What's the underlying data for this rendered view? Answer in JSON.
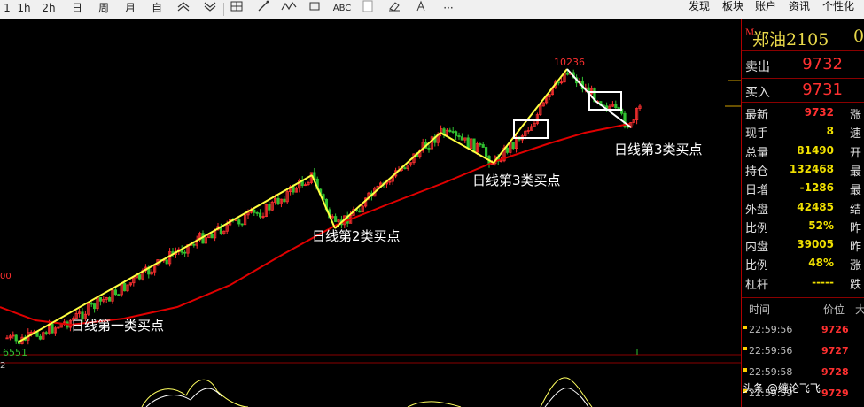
{
  "toolbar": {
    "left_buttons": [
      "1",
      "1h",
      "2h",
      "日",
      "周",
      "月",
      "自"
    ],
    "tools": [
      "zoom-in-icon",
      "zoom-out-icon",
      "grid-icon",
      "line-draw-icon",
      "wave-icon",
      "rect-icon",
      "ABC",
      "blank-icon",
      "eraser-icon",
      "more-icon"
    ],
    "abc_label": "ABC",
    "more_label": "···",
    "menu": [
      "发现",
      "板块",
      "账户",
      "资讯",
      "个性化"
    ]
  },
  "panel": {
    "title": "郑油2105",
    "title_suffix": "0",
    "title_marker": "M",
    "sell_label": "卖出",
    "sell_price": "9732",
    "buy_label": "买入",
    "buy_price": "9731",
    "stats": [
      {
        "label": "最新",
        "value": "9732",
        "color": "#ff3030",
        "right": "涨"
      },
      {
        "label": "现手",
        "value": "8",
        "color": "#f0e000",
        "right": "速"
      },
      {
        "label": "总量",
        "value": "81490",
        "color": "#f0e000",
        "right": "开"
      },
      {
        "label": "持仓",
        "value": "132468",
        "color": "#f0e000",
        "right": "最"
      },
      {
        "label": "日增",
        "value": "-1286",
        "color": "#f0e000",
        "right": "最"
      },
      {
        "label": "外盘",
        "value": "42485",
        "color": "#f0e000",
        "right": "结"
      },
      {
        "label": "比例",
        "value": "52%",
        "color": "#f0e000",
        "right": "昨"
      },
      {
        "label": "内盘",
        "value": "39005",
        "color": "#f0e000",
        "right": "昨"
      },
      {
        "label": "比例",
        "value": "48%",
        "color": "#f0e000",
        "right": "涨"
      },
      {
        "label": "杠杆",
        "value": "-----",
        "color": "#f0e000",
        "right": "跌"
      }
    ],
    "ticks_header": {
      "time": "时间",
      "price": "价位",
      "vol": "大"
    },
    "ticks": [
      {
        "time": "22:59:56",
        "price": "9726"
      },
      {
        "time": "22:59:56",
        "price": "9727"
      },
      {
        "time": "22:59:58",
        "price": "9728"
      },
      {
        "time": "22:59:59",
        "price": "9729"
      }
    ]
  },
  "chart": {
    "high_label": "10236",
    "low_label": "6551",
    "left_edge_label_top": "00",
    "left_edge_label_bottom": "2",
    "annotations": {
      "buy1": "日线第一类买点",
      "buy2": "日线第2类买点",
      "buy3a": "日线第3类买点",
      "buy3b": "日线第3类买点"
    },
    "colors": {
      "up": "#ff3030",
      "down": "#30c030",
      "ma": "#e00000",
      "trend": "#ffff40",
      "box": "#ffffff"
    }
  },
  "watermark": "头条 @缠论飞飞"
}
